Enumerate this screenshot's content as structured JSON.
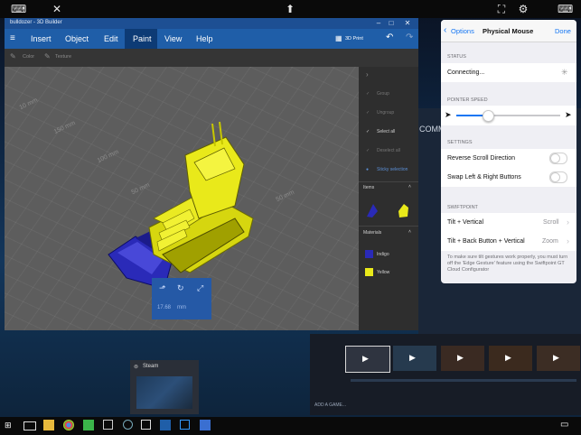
{
  "toolbar_icons": [
    "keyboard-icon",
    "close-icon",
    "pin-icon",
    "fullscreen-icon",
    "settings-icon",
    "keyboard-icon"
  ],
  "builder": {
    "title": "bulldozer - 3D Builder",
    "menu": [
      "Insert",
      "Object",
      "Edit",
      "Paint",
      "View",
      "Help"
    ],
    "active_menu": "Paint",
    "print_label": "3D Print",
    "sub_tools": [
      "Color",
      "Texture"
    ],
    "dimensions": [
      "10 mm",
      "150 mm",
      "100 mm",
      "50 mm",
      "50 mm"
    ],
    "right_actions": [
      "Group",
      "Ungroup",
      "Select all",
      "Deselect all",
      "Sticky selection"
    ],
    "items_title": "Items",
    "materials_title": "Materials",
    "materials": [
      {
        "name": "Indigo",
        "color": "#2a2ab8"
      },
      {
        "name": "Yellow",
        "color": "#e9e91a"
      }
    ],
    "measure_value": "17.68",
    "measure_unit": "mm"
  },
  "steam": {
    "label": "Steam"
  },
  "store": {
    "add_game": "ADD A GAME...",
    "comm_text": "COMM"
  },
  "popover": {
    "back_label": "Options",
    "title": "Physical Mouse",
    "done_label": "Done",
    "status_header": "STATUS",
    "status_value": "Connecting...",
    "pointer_header": "POINTER SPEED",
    "pointer_speed": 0.3,
    "settings_header": "SETTINGS",
    "reverse_scroll": "Reverse Scroll Direction",
    "swap_buttons": "Swap Left & Right Buttons",
    "swiftpoint_header": "SWIFTPOINT",
    "tilt_vertical": "Tilt + Vertical",
    "tilt_vertical_value": "Scroll",
    "tilt_back": "Tilt + Back Button + Vertical",
    "tilt_back_value": "Zoom",
    "footnote": "To make sure tilt gestures work properly, you must turn off the 'Edge Gesture' feature using the Swiftpoint GT Cloud Configurator"
  },
  "colors": {
    "accent": "#1476f3",
    "builder_blue": "#1f5ea8",
    "model_yellow": "#e9e91a",
    "model_indigo": "#2a2ab8"
  }
}
